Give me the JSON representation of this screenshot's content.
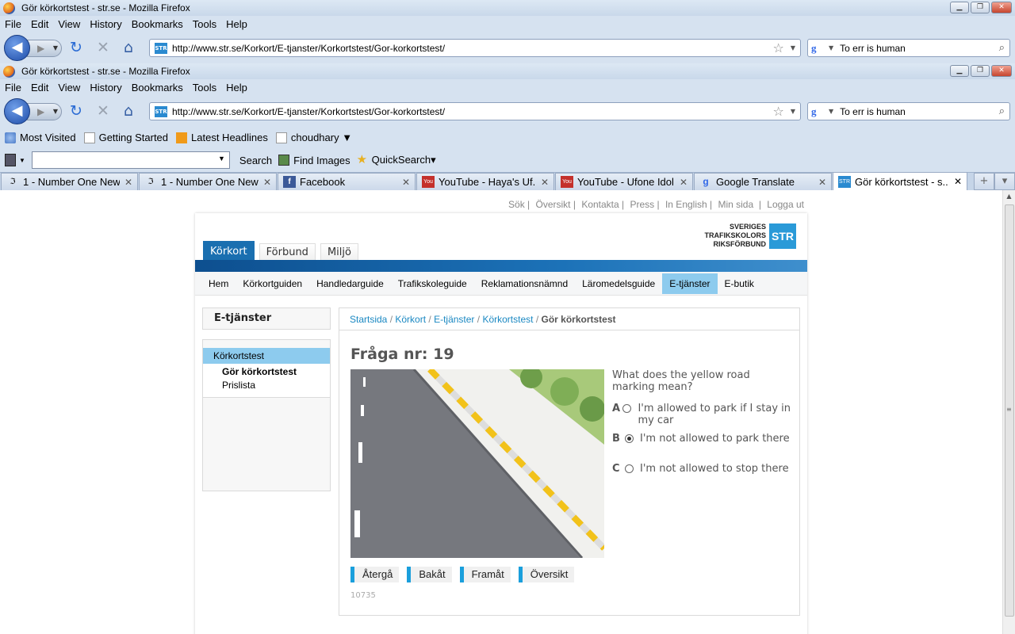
{
  "window1": {
    "title": "Gör körkortstest - str.se - Mozilla Firefox",
    "menus": [
      "File",
      "Edit",
      "View",
      "History",
      "Bookmarks",
      "Tools",
      "Help"
    ],
    "url": "http://www.str.se/Korkort/E-tjanster/Korkortstest/Gor-korkortstest/",
    "search": "To err is human"
  },
  "window2": {
    "title": "Gör körkortstest - str.se - Mozilla Firefox",
    "menus": [
      "File",
      "Edit",
      "View",
      "History",
      "Bookmarks",
      "Tools",
      "Help"
    ],
    "url": "http://www.str.se/Korkort/E-tjanster/Korkortstest/Gor-korkortstest/",
    "search": "To err is human",
    "bookmarks": [
      "Most Visited",
      "Getting Started",
      "Latest Headlines",
      "choudhary ▼"
    ],
    "toolbar": {
      "search": "Search",
      "find_images": "Find Images",
      "quicksearch": "QuickSearch▾"
    },
    "tabs": [
      {
        "label": "1 - Number One New...",
        "icon": "number-one-icon"
      },
      {
        "label": "1 - Number One New...",
        "icon": "number-one-icon"
      },
      {
        "label": "Facebook",
        "icon": "facebook-icon"
      },
      {
        "label": "YouTube - Haya's Uf...",
        "icon": "youtube-icon"
      },
      {
        "label": "YouTube - Ufone Idol...",
        "icon": "youtube-icon"
      },
      {
        "label": "Google Translate",
        "icon": "google-icon"
      },
      {
        "label": "Gör körkortstest - s...",
        "icon": "str-icon"
      }
    ]
  },
  "site": {
    "util_links": [
      "Sök",
      "Översikt",
      "Kontakta",
      "Press",
      "In English",
      "Min sida",
      "Logga ut"
    ],
    "main_tabs": [
      "Körkort",
      "Förbund",
      "Miljö"
    ],
    "logo": {
      "line1": "SVERIGES",
      "line2": "TRAFIKSKOLORS",
      "line3": "RIKSFÖRBUND",
      "badge": "STR"
    },
    "subnav": [
      "Hem",
      "Körkortguiden",
      "Handledarguide",
      "Trafikskoleguide",
      "Reklamationsnämnd",
      "Läromedelsguide",
      "E-tjänster",
      "E-butik"
    ],
    "side_title": "E-tjänster",
    "side_active": "Körkortstest",
    "side_children": [
      "Gör körkortstest",
      "Prislista"
    ],
    "breadcrumb": [
      "Startsida",
      "Körkort",
      "E-tjänster",
      "Körkortstest"
    ],
    "breadcrumb_current": "Gör körkortstest",
    "question_title": "Fråga nr: 19",
    "question_text": "What does the yellow road marking mean?",
    "options": [
      {
        "letter": "A",
        "text": "I'm allowed to park if I stay in my car",
        "selected": false
      },
      {
        "letter": "B",
        "text": "I'm not allowed to park there",
        "selected": true
      },
      {
        "letter": "C",
        "text": "I'm not allowed to stop there",
        "selected": false
      }
    ],
    "buttons": [
      "Återgå",
      "Bakåt",
      "Framåt",
      "Översikt"
    ],
    "question_id": "10735"
  }
}
